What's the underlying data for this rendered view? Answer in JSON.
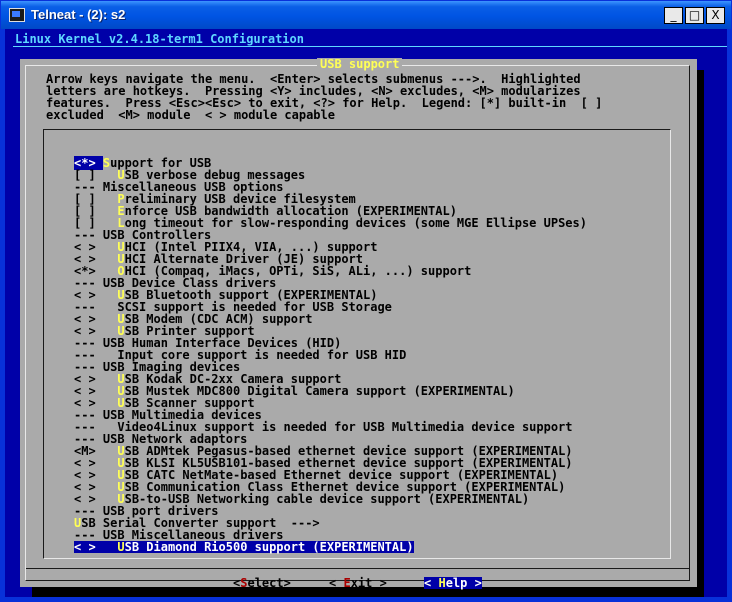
{
  "window": {
    "title": "Telneat - (2): s2",
    "minimize_glyph": "_",
    "maximize_glyph": "□",
    "close_glyph": "X"
  },
  "terminal": {
    "header": "Linux Kernel v2.4.18-term1 Configuration"
  },
  "dialog": {
    "title": "USB support",
    "instructions": [
      "Arrow keys navigate the menu.  <Enter> selects submenus --->.  Highlighted",
      "letters are hotkeys.  Pressing <Y> includes, <N> excludes, <M> modularizes",
      "features.  Press <Esc><Esc> to exit, <?> for Help.  Legend: [*] built-in  [ ]",
      "excluded  <M> module  < > module capable"
    ]
  },
  "menu": {
    "items": [
      {
        "prefix": "<*> ",
        "hot": "S",
        "rest": "upport for USB",
        "selected": false,
        "focus": true
      },
      {
        "prefix": "[ ]   ",
        "hot": "U",
        "rest": "SB verbose debug messages"
      },
      {
        "prefix": "--- ",
        "hot": "",
        "rest": "Miscellaneous USB options"
      },
      {
        "prefix": "[ ]   ",
        "hot": "P",
        "rest": "reliminary USB device filesystem"
      },
      {
        "prefix": "[ ]   ",
        "hot": "E",
        "rest": "nforce USB bandwidth allocation (EXPERIMENTAL)"
      },
      {
        "prefix": "[ ]   ",
        "hot": "L",
        "rest": "ong timeout for slow-responding devices (some MGE Ellipse UPSes)"
      },
      {
        "prefix": "--- ",
        "hot": "",
        "rest": "USB Controllers"
      },
      {
        "prefix": "< >   ",
        "hot": "U",
        "rest": "HCI (Intel PIIX4, VIA, ...) support"
      },
      {
        "prefix": "< >   ",
        "hot": "U",
        "rest": "HCI Alternate Driver (JE) support"
      },
      {
        "prefix": "<*>   ",
        "hot": "O",
        "rest": "HCI (Compaq, iMacs, OPTi, SiS, ALi, ...) support"
      },
      {
        "prefix": "--- ",
        "hot": "",
        "rest": "USB Device Class drivers"
      },
      {
        "prefix": "< >   ",
        "hot": "U",
        "rest": "SB Bluetooth support (EXPERIMENTAL)"
      },
      {
        "prefix": "---   ",
        "hot": "",
        "rest": "SCSI support is needed for USB Storage"
      },
      {
        "prefix": "< >   ",
        "hot": "U",
        "rest": "SB Modem (CDC ACM) support"
      },
      {
        "prefix": "< >   ",
        "hot": "U",
        "rest": "SB Printer support"
      },
      {
        "prefix": "--- ",
        "hot": "",
        "rest": "USB Human Interface Devices (HID)"
      },
      {
        "prefix": "---   ",
        "hot": "",
        "rest": "Input core support is needed for USB HID"
      },
      {
        "prefix": "--- ",
        "hot": "",
        "rest": "USB Imaging devices"
      },
      {
        "prefix": "< >   ",
        "hot": "U",
        "rest": "SB Kodak DC-2xx Camera support"
      },
      {
        "prefix": "< >   ",
        "hot": "U",
        "rest": "SB Mustek MDC800 Digital Camera support (EXPERIMENTAL)"
      },
      {
        "prefix": "< >   ",
        "hot": "U",
        "rest": "SB Scanner support"
      },
      {
        "prefix": "--- ",
        "hot": "",
        "rest": "USB Multimedia devices"
      },
      {
        "prefix": "---   ",
        "hot": "",
        "rest": "Video4Linux support is needed for USB Multimedia device support"
      },
      {
        "prefix": "--- ",
        "hot": "",
        "rest": "USB Network adaptors"
      },
      {
        "prefix": "<M>   ",
        "hot": "U",
        "rest": "SB ADMtek Pegasus-based ethernet device support (EXPERIMENTAL)"
      },
      {
        "prefix": "< >   ",
        "hot": "U",
        "rest": "SB KLSI KL5USB101-based ethernet device support (EXPERIMENTAL)"
      },
      {
        "prefix": "< >   ",
        "hot": "U",
        "rest": "SB CATC NetMate-based Ethernet device support (EXPERIMENTAL)"
      },
      {
        "prefix": "< >   ",
        "hot": "U",
        "rest": "SB Communication Class Ethernet device support (EXPERIMENTAL)"
      },
      {
        "prefix": "< >   ",
        "hot": "U",
        "rest": "SB-to-USB Networking cable device support (EXPERIMENTAL)"
      },
      {
        "prefix": "--- ",
        "hot": "",
        "rest": "USB port drivers"
      },
      {
        "prefix": "",
        "hot": "U",
        "rest": "SB Serial Converter support  --->"
      },
      {
        "prefix": "--- ",
        "hot": "",
        "rest": "USB Miscellaneous drivers"
      },
      {
        "prefix": "< >   ",
        "hot": "U",
        "rest": "SB Diamond Rio500 support (EXPERIMENTAL)",
        "selected": true
      }
    ]
  },
  "buttons": {
    "select": {
      "open": "<",
      "hot": "S",
      "rest": "elect",
      "close": ">"
    },
    "exit": {
      "open": "< ",
      "hot": "E",
      "rest": "xit",
      "close": " >"
    },
    "help": {
      "open": "< ",
      "hot": "H",
      "rest": "elp",
      "close": " >"
    }
  }
}
